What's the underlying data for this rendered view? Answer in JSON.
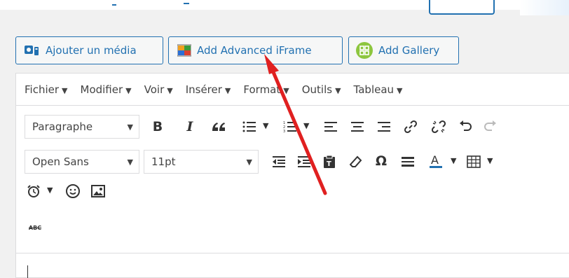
{
  "media_buttons": {
    "add_media": "Ajouter un média",
    "add_iframe": "Add Advanced iFrame",
    "add_gallery": "Add Gallery"
  },
  "menubar": {
    "file": "Fichier",
    "edit": "Modifier",
    "view": "Voir",
    "insert": "Insérer",
    "format": "Format",
    "tools": "Outils",
    "table": "Tableau"
  },
  "toolbar": {
    "format_select": "Paragraphe",
    "font_family": "Open Sans",
    "font_size": "11pt",
    "bold": "B",
    "italic": "I",
    "strike_abbr": "ABC"
  },
  "colors": {
    "accent": "#2271b1",
    "arrow": "#e02020",
    "gallery_icon": "#8dc63f"
  }
}
